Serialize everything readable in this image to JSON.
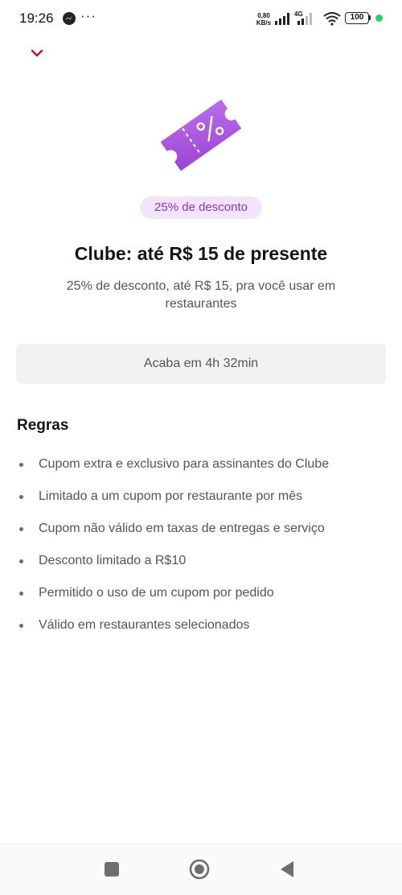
{
  "status_bar": {
    "time": "19:26",
    "overflow_dots": "···",
    "network_speed_value": "0,80",
    "network_speed_unit": "KB/s",
    "network_type": "4G",
    "battery": "100",
    "indicator_color": "#2ecc71"
  },
  "header": {
    "collapse_icon": "chevron-down-icon",
    "accent_color": "#c1121f"
  },
  "hero": {
    "icon": "coupon-ticket-percent-icon",
    "icon_color": "#a855e0",
    "badge": "25% de desconto",
    "badge_bg": "#f2e4fb",
    "badge_color": "#8e35c4",
    "title": "Clube: até R$ 15 de presente",
    "subtitle": "25% de desconto, até R$ 15, pra você usar em restaurantes"
  },
  "timer": {
    "label": "Acaba em 4h 32min"
  },
  "rules": {
    "title": "Regras",
    "items": [
      "Cupom extra e exclusivo para assinantes do Clube",
      "Limitado a um cupom por restaurante por mês",
      "Cupom não válido em taxas de entregas e serviço",
      "Desconto limitado a R$10",
      "Permitido o uso de um cupom por pedido",
      "Válido em restaurantes selecionados"
    ]
  },
  "nav_bar": {
    "recent_icon": "square-recent-apps-icon",
    "home_icon": "circle-home-icon",
    "back_icon": "triangle-back-icon"
  }
}
